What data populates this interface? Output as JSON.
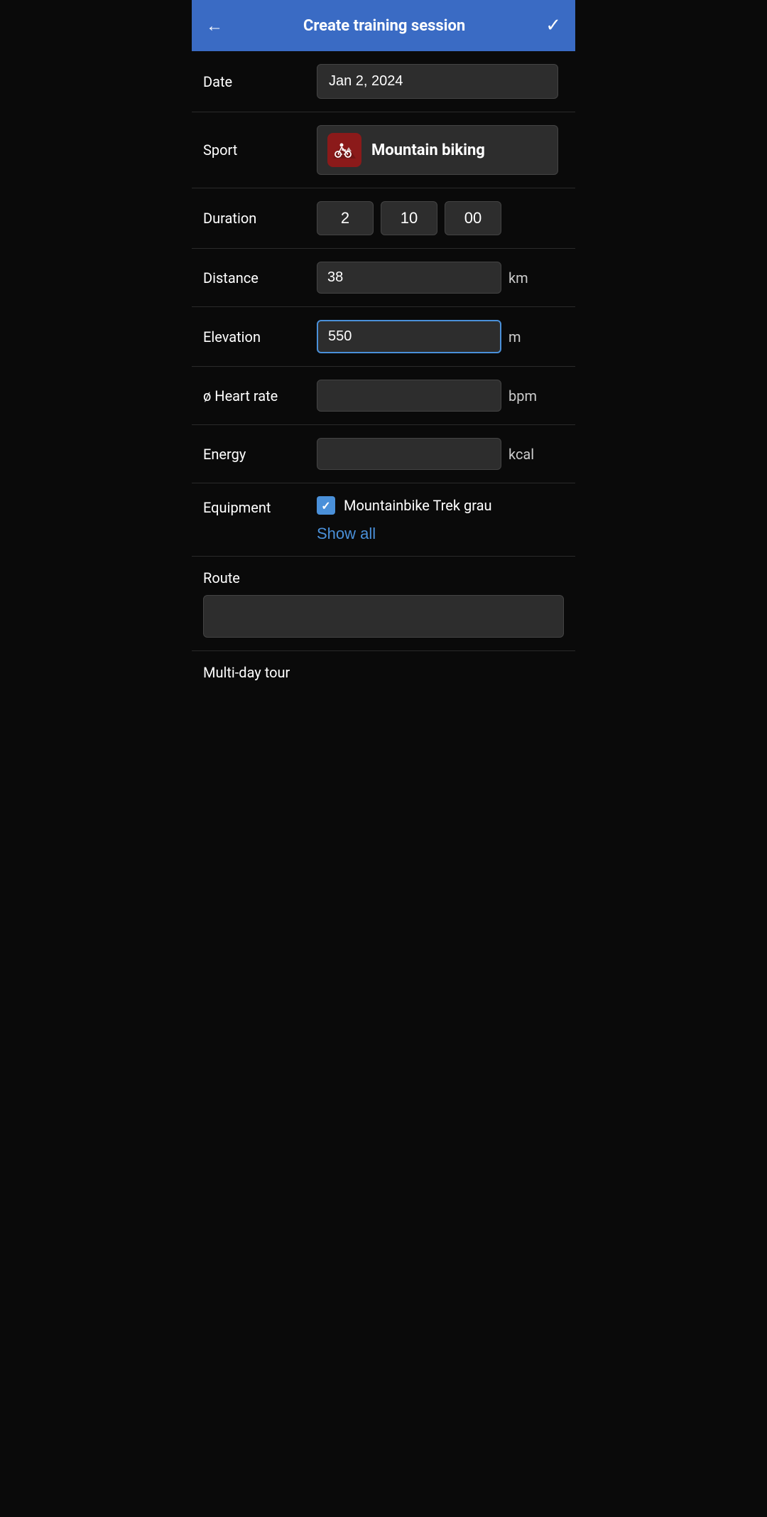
{
  "header": {
    "title": "Create training session",
    "back_icon": "←",
    "check_icon": "✓"
  },
  "form": {
    "date": {
      "label": "Date",
      "value": "Jan 2, 2024"
    },
    "sport": {
      "label": "Sport",
      "value": "Mountain biking",
      "icon": "🚵"
    },
    "duration": {
      "label": "Duration",
      "hours": "2",
      "minutes": "10",
      "seconds": "00"
    },
    "distance": {
      "label": "Distance",
      "value": "38",
      "unit": "km"
    },
    "elevation": {
      "label": "Elevation",
      "value": "550",
      "unit": "m"
    },
    "heart_rate": {
      "label": "ø Heart rate",
      "value": "",
      "unit": "bpm"
    },
    "energy": {
      "label": "Energy",
      "value": "",
      "unit": "kcal"
    },
    "equipment": {
      "label": "Equipment",
      "items": [
        {
          "name": "Mountainbike Trek grau",
          "checked": true
        }
      ],
      "show_all_label": "Show all"
    },
    "route": {
      "label": "Route",
      "value": ""
    },
    "multi_day_tour": {
      "label": "Multi-day tour"
    }
  }
}
